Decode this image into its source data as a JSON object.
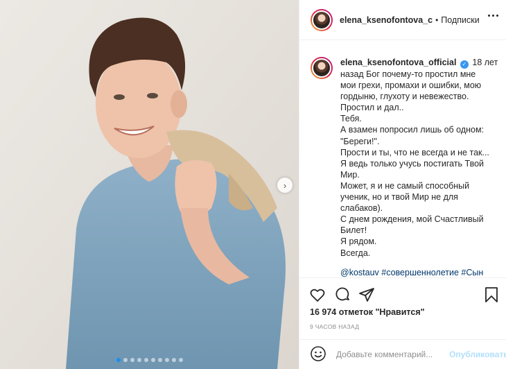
{
  "photo": {
    "description_label": "",
    "slide_count": 10,
    "active_slide": 1,
    "next_arrow": "›"
  },
  "header": {
    "username": "elena_ksenofontova_c",
    "separator": "•",
    "follow_status": "Подписки",
    "more_icon": "more-horizontal-icon"
  },
  "caption": {
    "author": "elena_ksenofontova_official",
    "verified_icon": "✓",
    "lines": [
      "18 лет",
      "назад Бог почему-то простил мне",
      "мои грехи, промахи и ошибки, мою",
      "гордыню, глухоту и невежество.",
      "Простил и дал..",
      "Тебя.",
      "А взамен попросил лишь об одном:",
      "\"Береги!\".",
      "Прости и ты, что не всегда и не так...",
      "Я ведь только учусь постигать Твой",
      "Мир.",
      "Может, я и не самый способный",
      "ученик, но и твой Мир не для",
      "слабаков).",
      "С днем рождения, мой Счастливый",
      "Билет!",
      "Я рядом.",
      "Всегда."
    ],
    "hashtags": "@kostauv #совершеннолетие #Сын"
  },
  "actions": {
    "like_icon": "heart-icon",
    "comment_icon": "comment-icon",
    "share_icon": "paper-plane-icon",
    "save_icon": "bookmark-icon"
  },
  "likes_text": "16 974 отметок \"Нравится\"",
  "timestamp": "9 ЧАСОВ НАЗАД",
  "comment": {
    "placeholder": "Добавьте комментарий...",
    "publish_label": "Опубликовать"
  },
  "colors": {
    "link": "#00376b",
    "publish_disabled": "#b2dffc",
    "verified": "#3897f0",
    "active_dot": "#1a8ff0"
  }
}
